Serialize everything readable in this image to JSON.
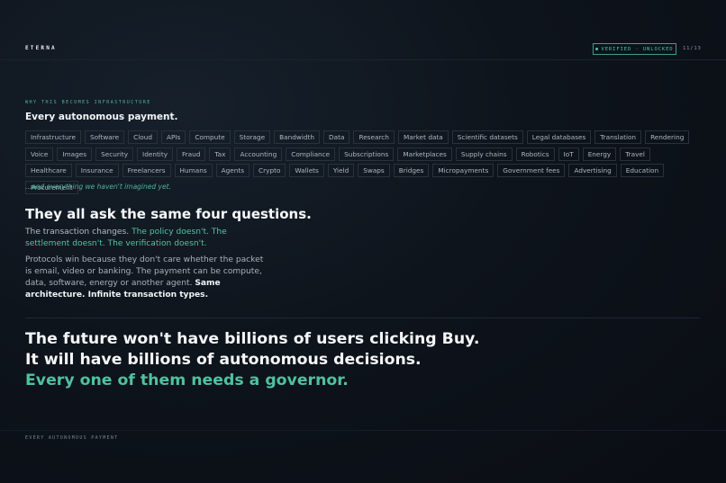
{
  "header": {
    "brand": "ETERNA",
    "badge": "VERIFIED · UNLOCKED",
    "page": "11/13"
  },
  "section": {
    "eyebrow": "WHY THIS BECOMES INFRASTRUCTURE",
    "title": "Every autonomous payment.",
    "tags": [
      "Infrastructure",
      "Software",
      "Cloud",
      "APIs",
      "Compute",
      "Storage",
      "Bandwidth",
      "Data",
      "Research",
      "Market data",
      "Scientific datasets",
      "Legal databases",
      "Translation",
      "Rendering",
      "Voice",
      "Images",
      "Security",
      "Identity",
      "Fraud",
      "Tax",
      "Accounting",
      "Compliance",
      "Subscriptions",
      "Marketplaces",
      "Supply chains",
      "Robotics",
      "IoT",
      "Energy",
      "Travel",
      "Healthcare",
      "Insurance",
      "Freelancers",
      "Humans",
      "Agents",
      "Crypto",
      "Wallets",
      "Yield",
      "Swaps",
      "Bridges",
      "Micropayments",
      "Government fees",
      "Advertising",
      "Education",
      "Procurement"
    ],
    "more": "...and everything we haven't imagined yet."
  },
  "questions": {
    "heading": "They all ask the same four questions.",
    "lead_plain": "The transaction changes. ",
    "lead_accent": "The policy doesn't. The settlement doesn't. The verification doesn't.",
    "body_plain": "Protocols win because they don't care whether the packet is email, video or banking. The payment can be compute, data, software, energy or another agent. ",
    "body_bold": "Same architecture. Infinite transaction types."
  },
  "closing": {
    "line1": "The future won't have billions of users clicking Buy.",
    "line2": "It will have billions of autonomous decisions.",
    "line3": "Every one of them needs a governor."
  },
  "footer": {
    "label": "EVERY AUTONOMOUS PAYMENT"
  },
  "colors": {
    "accent": "#57c2a2",
    "background": "#0c1118"
  }
}
